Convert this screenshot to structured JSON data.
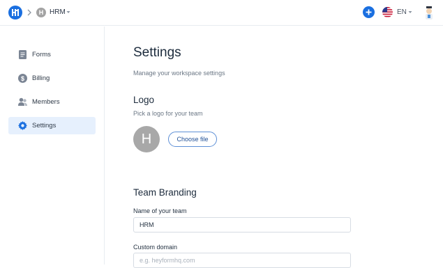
{
  "header": {
    "app_logo_icon": "heyform-logo-icon",
    "separator_icon": "chevron-right-icon",
    "workspace": {
      "initial": "H",
      "name": "HRM",
      "caret_icon": "caret-down-icon"
    },
    "add_icon": "plus-icon",
    "language": {
      "flag_icon": "us-flag-icon",
      "code": "EN",
      "caret_icon": "caret-down-icon"
    },
    "user_avatar_icon": "user-avatar-icon",
    "colors": {
      "accent": "#1a6fe0"
    }
  },
  "sidebar": {
    "items": [
      {
        "label": "Forms",
        "icon": "document-icon",
        "active": false
      },
      {
        "label": "Billing",
        "icon": "dollar-icon",
        "active": false
      },
      {
        "label": "Members",
        "icon": "users-icon",
        "active": false
      },
      {
        "label": "Settings",
        "icon": "gear-icon",
        "active": true
      }
    ]
  },
  "main": {
    "title": "Settings",
    "subtitle": "Manage your workspace settings",
    "logo_section": {
      "title": "Logo",
      "subtitle": "Pick a logo for your team",
      "placeholder_initial": "H",
      "choose_button": "Choose file"
    },
    "branding_section": {
      "title": "Team Branding",
      "team_name_label": "Name of your team",
      "team_name_value": "HRM",
      "custom_domain_label": "Custom domain",
      "custom_domain_placeholder": "e.g. heyformhq.com"
    }
  }
}
